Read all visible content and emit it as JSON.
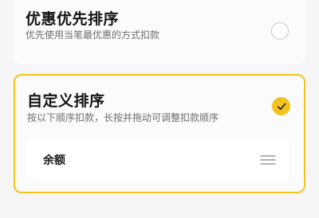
{
  "options": [
    {
      "title": "优惠优先排序",
      "subtitle": "优先使用当笔最优惠的方式扣款",
      "selected": false
    },
    {
      "title": "自定义排序",
      "subtitle": "按以下顺序扣款，长按并拖动可调整扣款顺序",
      "selected": true,
      "items": [
        {
          "label": "余额",
          "icon": "drag-handle-icon"
        }
      ]
    }
  ],
  "colors": {
    "accent": "#f4c21f",
    "border_selected": "#f1c419",
    "background": "#f6f6f6"
  },
  "icons": {
    "unselected": "radio-unselected-icon",
    "selected": "checkmark-icon",
    "reorder": "drag-handle-icon"
  }
}
